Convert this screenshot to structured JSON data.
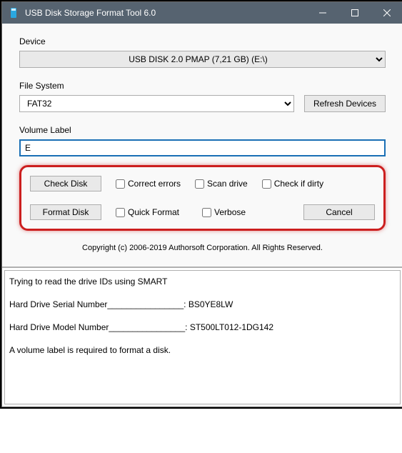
{
  "window": {
    "title": "USB Disk Storage Format Tool 6.0"
  },
  "device": {
    "label": "Device",
    "selected": "USB DISK 2.0  PMAP (7,21 GB) (E:\\)"
  },
  "filesystem": {
    "label": "File System",
    "selected": "FAT32",
    "refresh_label": "Refresh Devices"
  },
  "volume": {
    "label": "Volume Label",
    "value": "E"
  },
  "actions": {
    "check_disk": "Check Disk",
    "format_disk": "Format Disk",
    "cancel": "Cancel"
  },
  "checks": {
    "correct_errors": "Correct errors",
    "scan_drive": "Scan drive",
    "check_if_dirty": "Check if dirty",
    "quick_format": "Quick Format",
    "verbose": "Verbose"
  },
  "copyright": "Copyright (c) 2006-2019 Authorsoft Corporation. All Rights Reserved.",
  "log": {
    "line1": "Trying to read the drive IDs using SMART",
    "line2": "Hard Drive Serial Number________________: BS0YE8LW",
    "line3": "Hard Drive Model Number________________: ST500LT012-1DG142",
    "line4": "A volume label is required to format a disk."
  }
}
